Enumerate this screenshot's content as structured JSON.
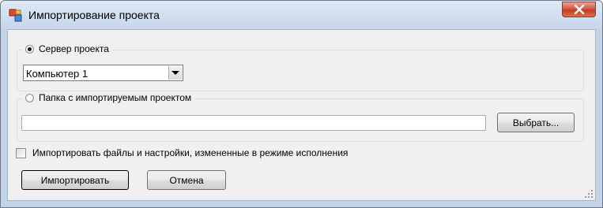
{
  "window": {
    "title": "Импортирование проекта"
  },
  "server_group": {
    "radio_label": "Сервер проекта",
    "selected": true,
    "dropdown_value": "Компьютер 1"
  },
  "folder_group": {
    "radio_label": "Папка с импортируемым проектом",
    "selected": false,
    "path_value": "",
    "browse_label": "Выбрать..."
  },
  "options": {
    "import_runtime_changes_label": "Импортировать файлы и настройки, измененные в режиме исполнения",
    "import_runtime_changes_checked": false
  },
  "actions": {
    "import_label": "Импортировать",
    "cancel_label": "Отмена"
  },
  "colors": {
    "close_button": "#c73b24",
    "client_background": "#f0f0f0",
    "title_bar": "#c6d6ea"
  },
  "icons": {
    "app": "project-import-icon",
    "close": "close-icon",
    "resize": "resize-grip-icon"
  }
}
